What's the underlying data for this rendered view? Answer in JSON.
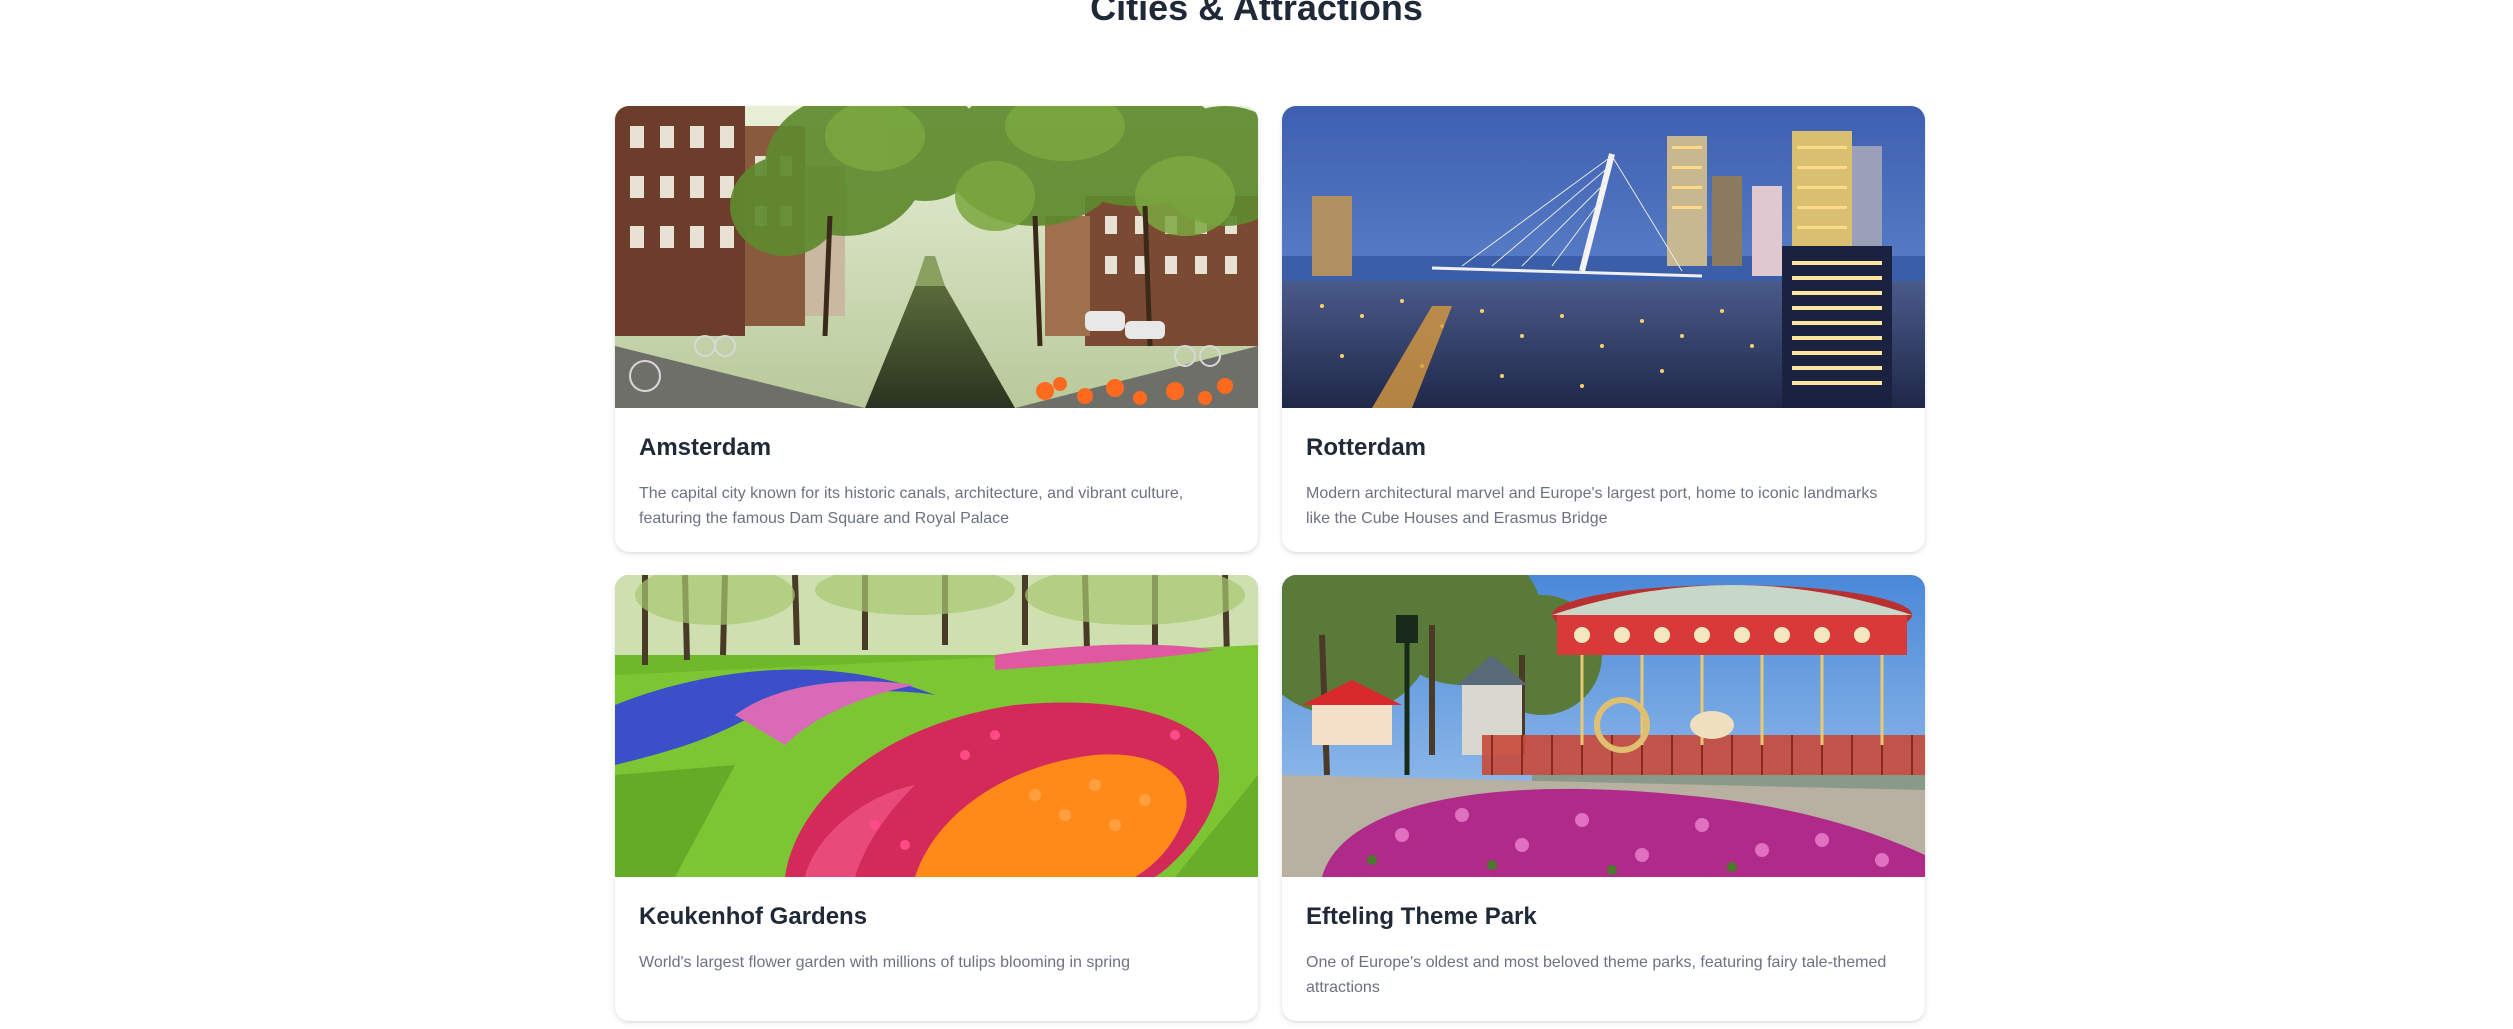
{
  "section": {
    "title": "Cities & Attractions"
  },
  "cards": [
    {
      "title": "Amsterdam",
      "description": "The capital city known for its historic canals, architecture, and vibrant culture, featuring the famous Dam Square and Royal Palace",
      "image": "amsterdam-canal-photo"
    },
    {
      "title": "Rotterdam",
      "description": "Modern architectural marvel and Europe's largest port, home to iconic landmarks like the Cube Houses and Erasmus Bridge",
      "image": "rotterdam-skyline-photo"
    },
    {
      "title": "Keukenhof Gardens",
      "description": "World's largest flower garden with millions of tulips blooming in spring",
      "image": "keukenhof-tulips-photo"
    },
    {
      "title": "Efteling Theme Park",
      "description": "One of Europe's oldest and most beloved theme parks, featuring fairy tale-themed attractions",
      "image": "efteling-carousel-photo"
    }
  ]
}
